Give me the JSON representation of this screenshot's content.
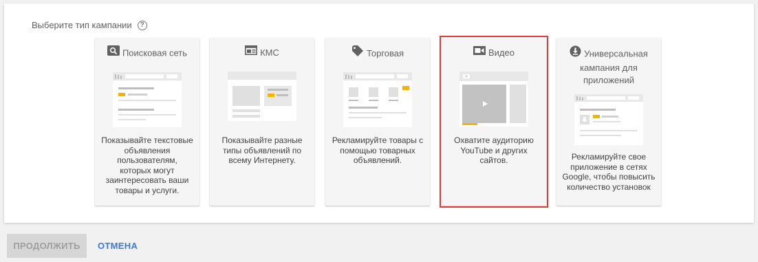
{
  "prompt": {
    "text": "Выберите тип кампании",
    "help_icon": "help-circle-icon"
  },
  "cards": [
    {
      "id": "search",
      "title": "Поисковая сеть",
      "icon": "search-icon",
      "description": "Показывайте текстовые объявления пользователям, которых могут заинтересовать ваши товары и услуги.",
      "selected": false
    },
    {
      "id": "display",
      "title": "КМС",
      "icon": "display-network-icon",
      "description": "Показывайте разные типы объявлений по всему Интернету.",
      "selected": false
    },
    {
      "id": "shopping",
      "title": "Торговая",
      "icon": "tag-icon",
      "description": "Рекламируйте товары с помощью товарных объявлений.",
      "selected": false
    },
    {
      "id": "video",
      "title": "Видео",
      "icon": "video-camera-icon",
      "description": "Охватите аудиторию YouTube и других сайтов.",
      "selected": true
    },
    {
      "id": "app",
      "title": "Универсальная кампания для приложений",
      "icon": "download-icon",
      "description": "Рекламируйте свое приложение в сетях Google, чтобы повысить количество установок",
      "selected": false
    }
  ],
  "footer": {
    "continue_label": "ПРОДОЛЖИТЬ",
    "cancel_label": "ОТМЕНА"
  },
  "colors": {
    "accent": "#3b78e7",
    "selection": "#e53935",
    "highlight": "#f4b400"
  }
}
